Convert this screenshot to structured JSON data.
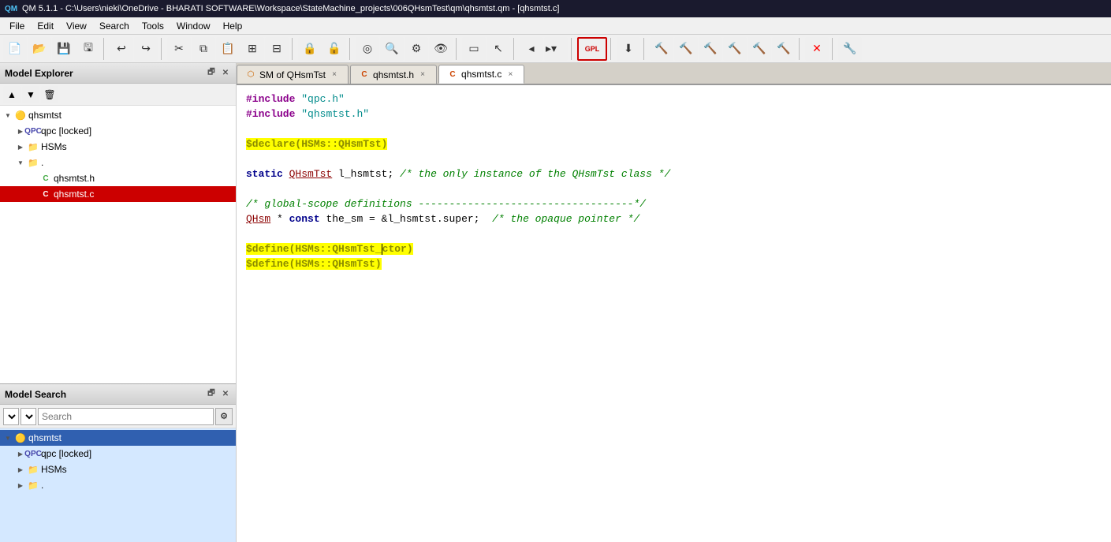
{
  "titleBar": {
    "title": "QM 5.1.1 - C:\\Users\\nieki\\OneDrive - BHARATI SOFTWARE\\Workspace\\StateMachine_projects\\006QHsmTest\\qm\\qhsmtst.qm - [qhsmtst.c]",
    "icon": "QM"
  },
  "menuBar": {
    "items": [
      "File",
      "Edit",
      "View",
      "Search",
      "Tools",
      "Window",
      "Help"
    ]
  },
  "toolbar": {
    "groups": [
      [
        "new",
        "open",
        "save-all",
        "save"
      ],
      [
        "undo",
        "redo"
      ],
      [
        "cut",
        "copy",
        "paste",
        "copy2",
        "paste2"
      ],
      [
        "lock",
        "unlock"
      ],
      [
        "target",
        "search",
        "adjust",
        "eye"
      ],
      [
        "screen",
        "pointer"
      ],
      [
        "nav-back",
        "nav-fwd"
      ],
      [
        "gpl"
      ],
      [
        "download"
      ],
      [
        "hammer",
        "hammer2",
        "hammer3",
        "hammer4",
        "hammer5",
        "hammer6"
      ],
      [
        "stop"
      ],
      [
        "wrench"
      ]
    ]
  },
  "modelExplorer": {
    "title": "Model Explorer",
    "tree": [
      {
        "id": "qhsmtst",
        "label": "qhsmtst",
        "level": 0,
        "toggle": "▼",
        "icon": "folder-yellow",
        "selected": false
      },
      {
        "id": "qpc",
        "label": "qpc [locked]",
        "level": 1,
        "toggle": "▶",
        "icon": "qpc-blue",
        "selected": false
      },
      {
        "id": "hsms",
        "label": "HSMs",
        "level": 1,
        "toggle": "▶",
        "icon": "folder-gray",
        "selected": false
      },
      {
        "id": "dot",
        "label": ".",
        "level": 1,
        "toggle": "▼",
        "icon": "folder-gray",
        "selected": false
      },
      {
        "id": "qhsmtst-h",
        "label": "qhsmtst.h",
        "level": 2,
        "toggle": "",
        "icon": "c-green",
        "selected": false
      },
      {
        "id": "qhsmtst-c",
        "label": "qhsmtst.c",
        "level": 2,
        "toggle": "",
        "icon": "c-red",
        "selected": true
      }
    ]
  },
  "modelSearch": {
    "title": "Model Search",
    "placeholder": "Search",
    "searchTree": [
      {
        "id": "qhsmtst-root",
        "label": "qhsmtst",
        "level": 0,
        "toggle": "▼",
        "icon": "folder-yellow",
        "selected": true
      },
      {
        "id": "qpc-s",
        "label": "qpc [locked]",
        "level": 1,
        "toggle": "▶",
        "icon": "qpc-blue",
        "selected": false
      },
      {
        "id": "hsms-s",
        "label": "HSMs",
        "level": 1,
        "toggle": "▶",
        "icon": "folder-gray",
        "selected": false
      },
      {
        "id": "dot-s",
        "label": ".",
        "level": 1,
        "toggle": "▶",
        "icon": "folder-gray",
        "selected": false
      }
    ]
  },
  "tabs": [
    {
      "id": "sm-tab",
      "label": "SM of QHsmTst",
      "icon": "sm-icon",
      "active": false,
      "closable": true
    },
    {
      "id": "h-tab",
      "label": "qhsmtst.h",
      "icon": "c-icon",
      "active": false,
      "closable": true
    },
    {
      "id": "c-tab",
      "label": "qhsmtst.c",
      "icon": "c-icon",
      "active": true,
      "closable": true
    }
  ],
  "codeEditor": {
    "lines": [
      {
        "id": 1,
        "content": "#include \"qpc.h\"",
        "type": "include"
      },
      {
        "id": 2,
        "content": "#include \"qhsmtst.h\"",
        "type": "include"
      },
      {
        "id": 3,
        "content": "",
        "type": "blank"
      },
      {
        "id": 4,
        "content": "$declare(HSMs::QHsmTst)",
        "type": "declare"
      },
      {
        "id": 5,
        "content": "",
        "type": "blank"
      },
      {
        "id": 6,
        "content": "static QHsmTst l_hsmtst; /* the only instance of the QHsmTst class */",
        "type": "static"
      },
      {
        "id": 7,
        "content": "",
        "type": "blank"
      },
      {
        "id": 8,
        "content": "/* global-scope definitions -----------------------------------*/",
        "type": "comment"
      },
      {
        "id": 9,
        "content": "QHsm * const the_sm = &l_hsmtst.super;  /* the opaque pointer */",
        "type": "code"
      },
      {
        "id": 10,
        "content": "",
        "type": "blank"
      },
      {
        "id": 11,
        "content": "$define(HSMs::QHsmTst_ctor)",
        "type": "define",
        "cursor": true,
        "cursorPos": 23
      },
      {
        "id": 12,
        "content": "$define(HSMs::QHsmTst)",
        "type": "define"
      }
    ]
  }
}
